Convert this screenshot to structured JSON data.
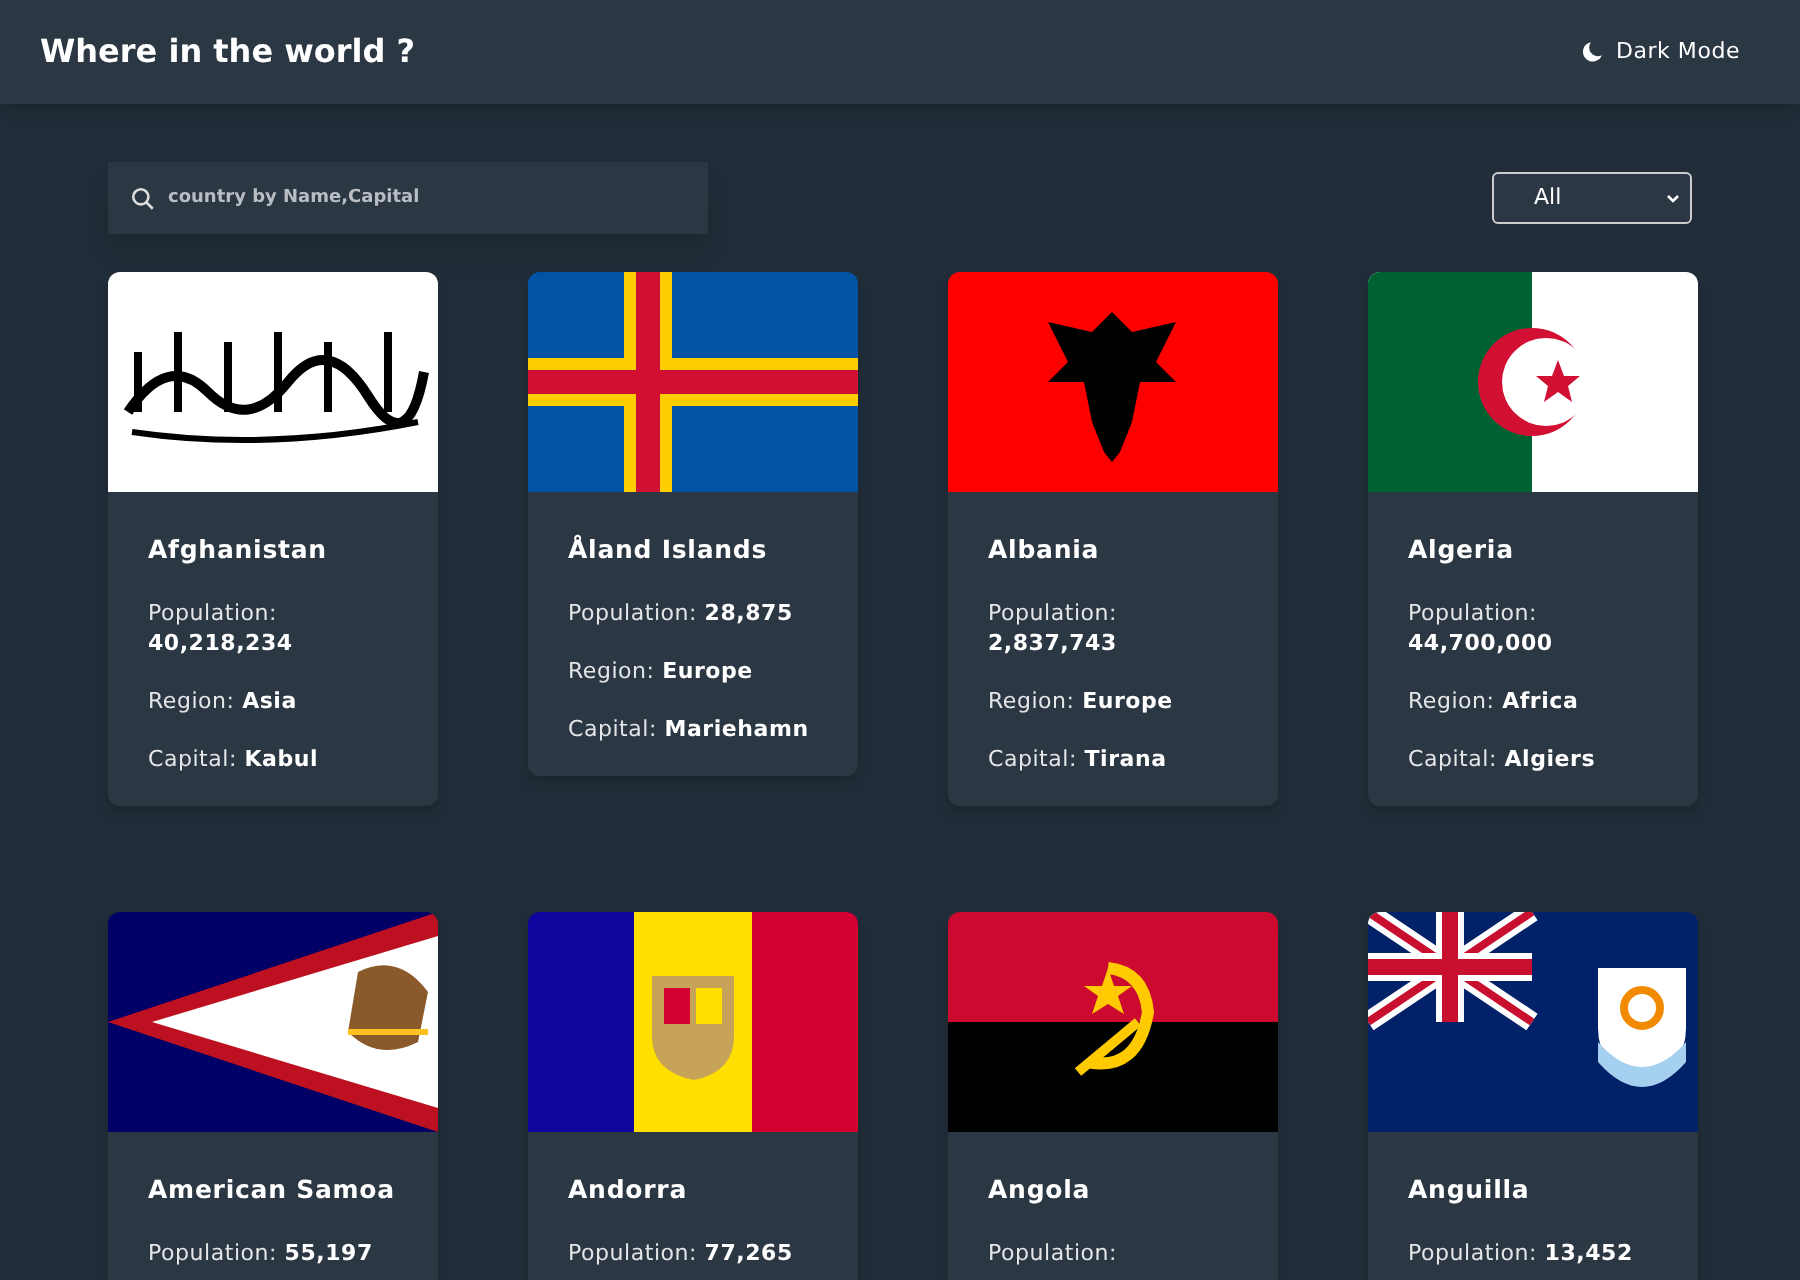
{
  "header": {
    "title": "Where in the world ?",
    "theme_toggle": "Dark Mode"
  },
  "search": {
    "placeholder": "country by Name,Capital"
  },
  "region_filter": {
    "value": "All"
  },
  "countries": [
    {
      "name": "Afghanistan",
      "population_label": "Population:",
      "population": "40,218,234",
      "region_label": "Region:",
      "region": "Asia",
      "capital_label": "Capital:",
      "capital": "Kabul"
    },
    {
      "name": "Åland Islands",
      "population_label": "Population:",
      "population": "28,875",
      "region_label": "Region:",
      "region": "Europe",
      "capital_label": "Capital:",
      "capital": "Mariehamn"
    },
    {
      "name": "Albania",
      "population_label": "Population:",
      "population": "2,837,743",
      "region_label": "Region:",
      "region": "Europe",
      "capital_label": "Capital:",
      "capital": "Tirana"
    },
    {
      "name": "Algeria",
      "population_label": "Population:",
      "population": "44,700,000",
      "region_label": "Region:",
      "region": "Africa",
      "capital_label": "Capital:",
      "capital": "Algiers"
    },
    {
      "name": "American Samoa",
      "population_label": "Population:",
      "population": "55,197"
    },
    {
      "name": "Andorra",
      "population_label": "Population:",
      "population": "77,265"
    },
    {
      "name": "Angola",
      "population_label": "Population:"
    },
    {
      "name": "Anguilla",
      "population_label": "Population:",
      "population": "13,452"
    }
  ]
}
